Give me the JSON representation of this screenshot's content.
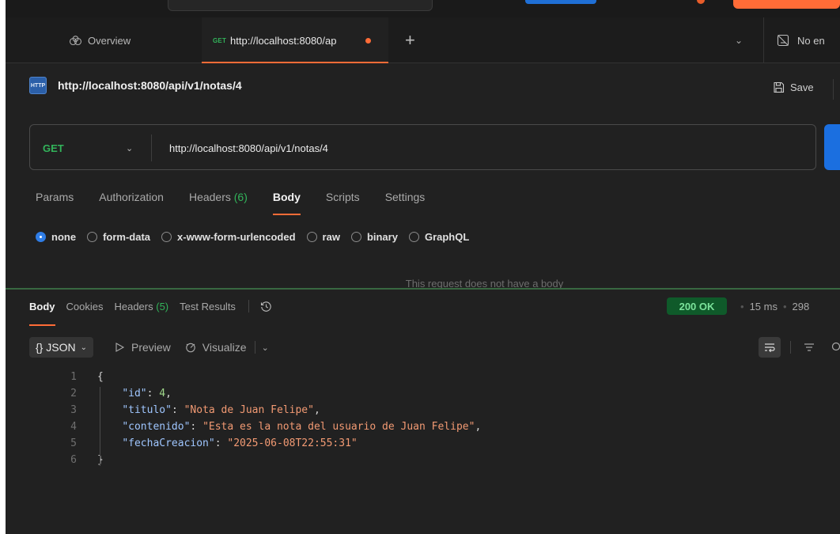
{
  "tabs": {
    "overview": "Overview",
    "active_method": "GET",
    "active_url": "http://localhost:8080/ap"
  },
  "environment": {
    "label": "No en"
  },
  "request": {
    "title": "http://localhost:8080/api/v1/notas/4",
    "save_label": "Save",
    "method": "GET",
    "url": "http://localhost:8080/api/v1/notas/4"
  },
  "request_tabs": {
    "params": "Params",
    "authorization": "Authorization",
    "headers": "Headers",
    "headers_count": "(6)",
    "body": "Body",
    "scripts": "Scripts",
    "settings": "Settings"
  },
  "body_types": {
    "none": "none",
    "form_data": "form-data",
    "urlencoded": "x-www-form-urlencoded",
    "raw": "raw",
    "binary": "binary",
    "graphql": "GraphQL"
  },
  "no_body_message": "This request does not have a body",
  "response": {
    "body": "Body",
    "cookies": "Cookies",
    "headers": "Headers",
    "headers_count": "(5)",
    "test_results": "Test Results",
    "status": "200 OK",
    "time": "15 ms",
    "size": "298"
  },
  "viewer": {
    "format": "JSON",
    "format_icon": "{}",
    "preview": "Preview",
    "visualize": "Visualize"
  },
  "code": {
    "line_numbers": [
      "1",
      "2",
      "3",
      "4",
      "5",
      "6"
    ],
    "open_brace": "{",
    "close_brace": "}",
    "fields": [
      {
        "key": "\"id\"",
        "value": "4"
      },
      {
        "key": "\"titulo\"",
        "value": "\"Nota de Juan Felipe\""
      },
      {
        "key": "\"contenido\"",
        "value": "\"Esta es la nota del usuario de Juan Felipe\""
      },
      {
        "key": "\"fechaCreacion\"",
        "value": "\"2025-06-08T22:55:31\""
      }
    ]
  },
  "colors": {
    "accent": "#ff6c37",
    "method_get": "#32b35a",
    "status_ok_bg": "#0f5a2a",
    "send_blue": "#1b6fe0"
  }
}
